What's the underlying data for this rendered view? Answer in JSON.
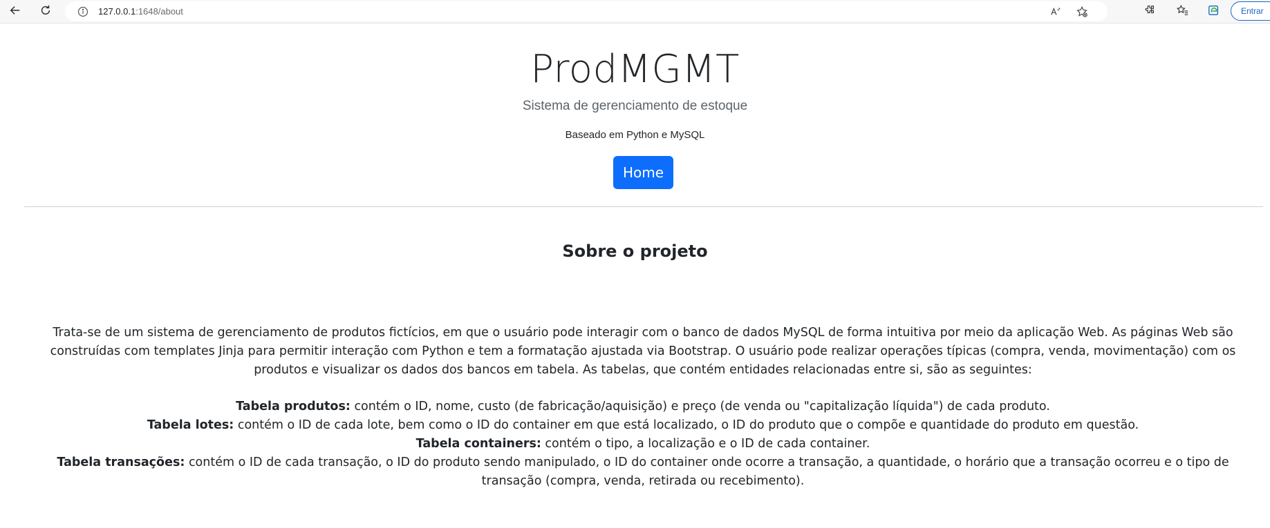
{
  "browser": {
    "url_host": "127.0.0.1",
    "url_path": ":1648/about",
    "signin_label": "Entrar"
  },
  "header": {
    "brand": "ProdMGMT",
    "subtitle": "Sistema de gerenciamento de estoque",
    "basis": "Baseado em Python e MySQL",
    "home_label": "Home"
  },
  "about": {
    "title": "Sobre o projeto",
    "description": "Trata-se de um sistema de gerenciamento de produtos fictícios, em que o usuário pode interagir com o banco de dados MySQL de forma intuitiva por meio da aplicação Web. As páginas Web são construídas com templates Jinja para permitir interação com Python e tem a formatação ajustada via Bootstrap. O usuário pode realizar operações típicas (compra, venda, movimentação) com os produtos e visualizar os dados dos bancos em tabela. As tabelas, que contém entidades relacionadas entre si, são as seguintes:",
    "tables": [
      {
        "name": "Tabela produtos:",
        "text": " contém o ID, nome, custo (de fabricação/aquisição) e preço (de venda ou \"capitalização líquida\") de cada produto."
      },
      {
        "name": "Tabela lotes:",
        "text": " contém o ID de cada lote, bem como o ID do container em que está localizado, o ID do produto que o compõe e quantidade do produto em questão."
      },
      {
        "name": "Tabela containers:",
        "text": " contém o tipo, a localização e o ID de cada container."
      },
      {
        "name": "Tabela transações:",
        "text": " contém o ID de cada transação, o ID do produto sendo manipulado, o ID do container onde ocorre a transação, a quantidade, o horário que a transação ocorreu e o tipo de transação (compra, venda, retirada ou recebimento)."
      }
    ]
  }
}
